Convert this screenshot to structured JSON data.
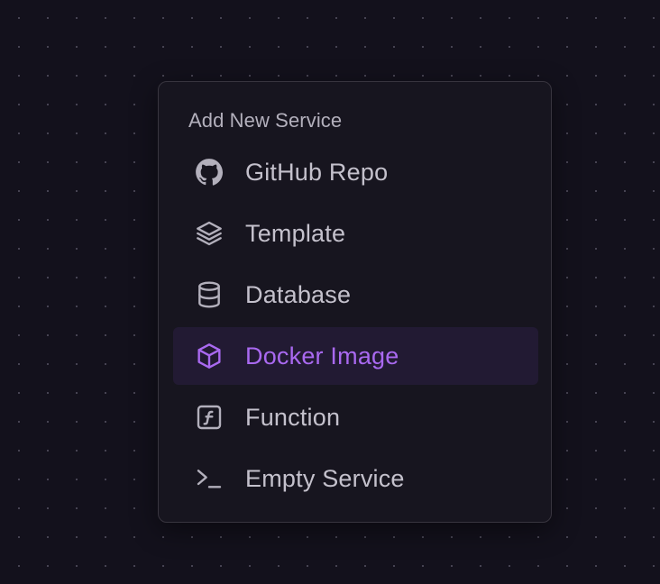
{
  "menu": {
    "title": "Add New Service",
    "items": [
      {
        "label": "GitHub Repo",
        "icon": "github-icon"
      },
      {
        "label": "Template",
        "icon": "layers-icon"
      },
      {
        "label": "Database",
        "icon": "database-icon"
      },
      {
        "label": "Docker Image",
        "icon": "box-icon",
        "active": true
      },
      {
        "label": "Function",
        "icon": "function-icon"
      },
      {
        "label": "Empty Service",
        "icon": "terminal-icon"
      }
    ]
  },
  "colors": {
    "background": "#13111c",
    "menu_background": "#17151f",
    "accent": "#a969f0",
    "active_background": "#221a33",
    "text": "#c4c1cc"
  }
}
